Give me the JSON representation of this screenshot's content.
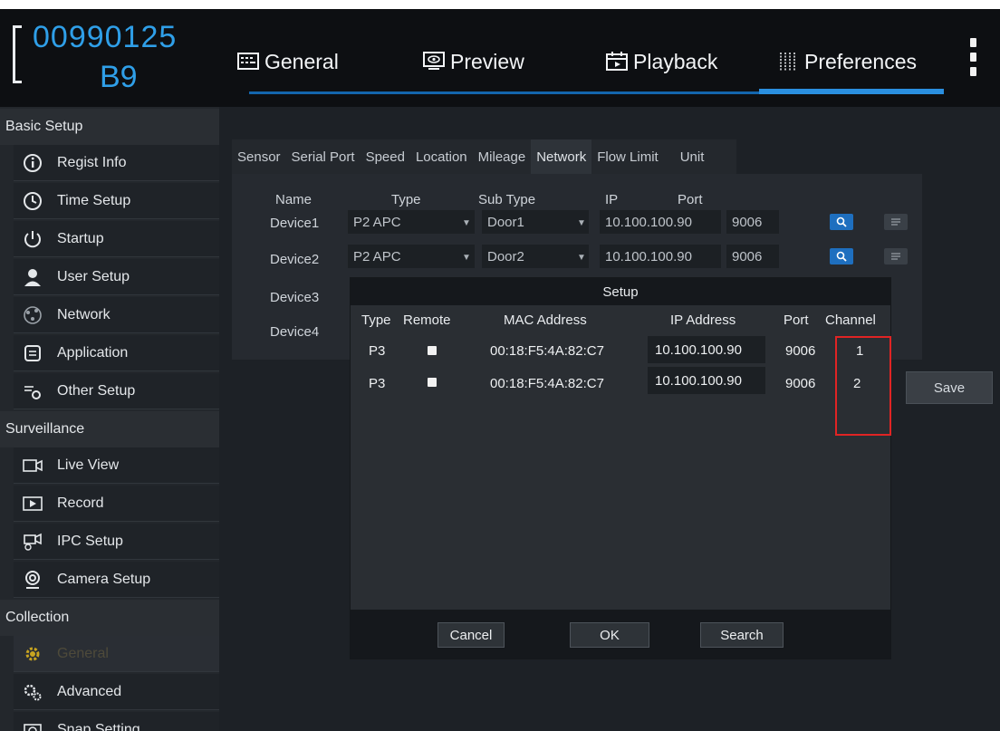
{
  "header": {
    "device_id_line1": "00990125",
    "device_id_line2": "B9",
    "tabs": [
      {
        "label": "General",
        "icon": "general-icon"
      },
      {
        "label": "Preview",
        "icon": "preview-icon"
      },
      {
        "label": "Playback",
        "icon": "playback-icon"
      },
      {
        "label": "Preferences",
        "icon": "preferences-icon",
        "active": true
      }
    ]
  },
  "sidebar": {
    "sections": [
      {
        "title": "Basic Setup",
        "items": [
          "Regist Info",
          "Time Setup",
          "Startup",
          "User Setup",
          "Network",
          "Application",
          "Other Setup"
        ]
      },
      {
        "title": "Surveillance",
        "items": [
          "Live View",
          "Record",
          "IPC Setup",
          "Camera Setup"
        ]
      },
      {
        "title": "Collection",
        "items": [
          "General",
          "Advanced",
          "Snap Setting"
        ],
        "active_item": "General"
      }
    ]
  },
  "subtabs": [
    "Sensor",
    "Serial Port",
    "Speed",
    "Location",
    "Mileage",
    "Network",
    "Flow Limit",
    "Unit"
  ],
  "active_subtab": "Network",
  "device_table": {
    "headers": {
      "name": "Name",
      "type": "Type",
      "sub_type": "Sub Type",
      "ip": "IP",
      "port": "Port"
    },
    "devices": [
      {
        "name": "Device1",
        "type": "P2 APC",
        "sub_type": "Door1",
        "ip": "10.100.100.90",
        "port": "9006"
      },
      {
        "name": "Device2",
        "type": "P2 APC",
        "sub_type": "Door2",
        "ip": "10.100.100.90",
        "port": "9006"
      },
      {
        "name": "Device3"
      },
      {
        "name": "Device4"
      }
    ]
  },
  "save_label": "Save",
  "dialog": {
    "title": "Setup",
    "headers": {
      "type": "Type",
      "remote": "Remote",
      "mac": "MAC Address",
      "ip": "IP Address",
      "port": "Port",
      "channel": "Channel"
    },
    "rows": [
      {
        "type": "P3",
        "remote": true,
        "mac": "00:18:F5:4A:82:C7",
        "ip": "10.100.100.90",
        "port": "9006",
        "channel": "1"
      },
      {
        "type": "P3",
        "remote": true,
        "mac": "00:18:F5:4A:82:C7",
        "ip": "10.100.100.90",
        "port": "9006",
        "channel": "2"
      }
    ],
    "buttons": {
      "cancel": "Cancel",
      "ok": "OK",
      "search": "Search"
    }
  },
  "colors": {
    "accent": "#2f9fe8",
    "highlight_frame": "#e02424",
    "active_underline": "#2a8fe0"
  }
}
